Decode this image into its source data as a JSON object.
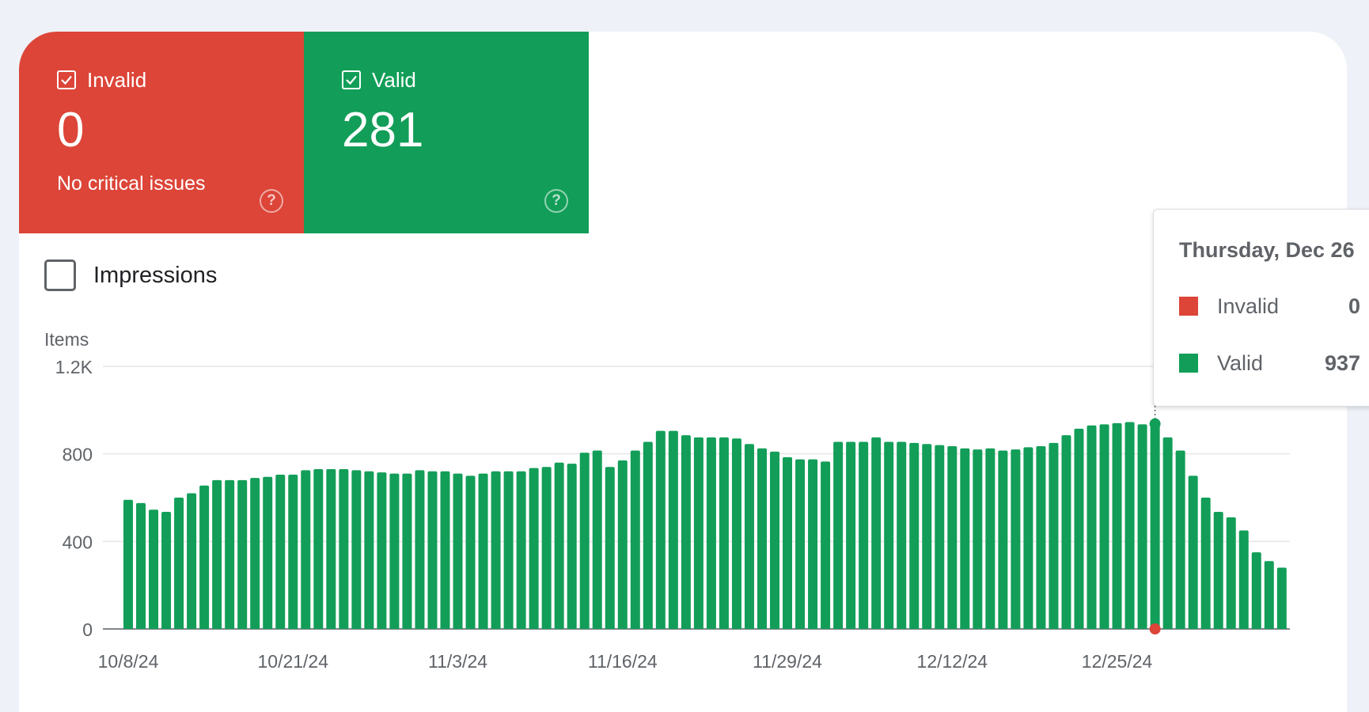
{
  "tiles": {
    "invalid": {
      "label": "Invalid",
      "value": "0",
      "subtitle": "No critical issues",
      "color": "#dc4538",
      "help_icon": "help-circle-icon",
      "checked": true
    },
    "valid": {
      "label": "Valid",
      "value": "281",
      "color": "#129e58",
      "help_icon": "help-circle-icon",
      "checked": true
    }
  },
  "impressions": {
    "label": "Impressions",
    "checked": false
  },
  "tooltip": {
    "title": "Thursday, Dec 26",
    "rows": [
      {
        "label": "Invalid",
        "value": "0",
        "color": "#dc4538"
      },
      {
        "label": "Valid",
        "value": "937",
        "color": "#129e58"
      }
    ]
  },
  "chart_data": {
    "type": "bar",
    "ylabel": "Items",
    "ylim": [
      0,
      1200
    ],
    "yticks": [
      "0",
      "400",
      "800",
      "1.2K"
    ],
    "ytick_values": [
      0,
      400,
      800,
      1200
    ],
    "xticks": [
      "10/8/24",
      "10/21/24",
      "11/3/24",
      "11/16/24",
      "11/29/24",
      "12/12/24",
      "12/25/24"
    ],
    "start_date": "10/8/24",
    "grid": true,
    "highlight_date": "12/26/24",
    "series": [
      {
        "name": "Invalid",
        "color": "#dc4538",
        "values": [
          0,
          0,
          0,
          0,
          0,
          0,
          0,
          0,
          0,
          0,
          0,
          0,
          0,
          0,
          0,
          0,
          0,
          0,
          0,
          0,
          0,
          0,
          0,
          0,
          0,
          0,
          0,
          0,
          0,
          0,
          0,
          0,
          0,
          0,
          0,
          0,
          0,
          0,
          0,
          0,
          0,
          0,
          0,
          0,
          0,
          0,
          0,
          0,
          0,
          0,
          0,
          0,
          0,
          0,
          0,
          0,
          0,
          0,
          0,
          0,
          0,
          0,
          0,
          0,
          0,
          0,
          0,
          0,
          0,
          0,
          0,
          0,
          0,
          0,
          0,
          0,
          0,
          0,
          0,
          0,
          0,
          0,
          0,
          0,
          0,
          0,
          0,
          0,
          0,
          0,
          0
        ]
      },
      {
        "name": "Valid",
        "color": "#129e58",
        "values": [
          590,
          575,
          545,
          535,
          600,
          620,
          655,
          680,
          680,
          680,
          690,
          695,
          705,
          705,
          725,
          730,
          730,
          730,
          725,
          720,
          715,
          710,
          710,
          725,
          720,
          720,
          710,
          700,
          710,
          720,
          720,
          720,
          735,
          740,
          760,
          755,
          805,
          815,
          740,
          770,
          815,
          855,
          905,
          905,
          885,
          875,
          875,
          875,
          870,
          845,
          825,
          810,
          785,
          775,
          775,
          765,
          855,
          855,
          855,
          875,
          855,
          855,
          850,
          845,
          840,
          835,
          825,
          820,
          825,
          815,
          820,
          830,
          835,
          850,
          885,
          915,
          930,
          935,
          940,
          945,
          935,
          937,
          875,
          815,
          700,
          600,
          535,
          510,
          450,
          350,
          310,
          280
        ]
      }
    ]
  }
}
